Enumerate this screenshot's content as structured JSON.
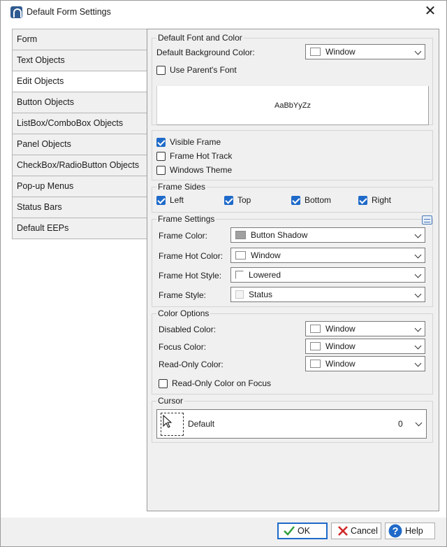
{
  "window": {
    "title": "Default Form Settings",
    "close_glyph": "✕"
  },
  "nav": {
    "items": [
      {
        "label": "Form"
      },
      {
        "label": "Text Objects"
      },
      {
        "label": "Edit Objects",
        "active": true
      },
      {
        "label": "Button Objects"
      },
      {
        "label": "ListBox/ComboBox Objects"
      },
      {
        "label": "Panel Objects"
      },
      {
        "label": "CheckBox/RadioButton Objects"
      },
      {
        "label": "Pop-up Menus"
      },
      {
        "label": "Status Bars"
      },
      {
        "label": "Default EEPs"
      }
    ]
  },
  "font_color": {
    "legend": "Default Font and Color",
    "bg_label": "Default Background Color:",
    "bg_value": "Window",
    "use_parent_font": {
      "label": "Use Parent's Font",
      "checked": false
    },
    "preview_text": "AaBbYyZz"
  },
  "frame_options": {
    "visible_frame": {
      "label": "Visible Frame",
      "checked": true
    },
    "frame_hot_track": {
      "label": "Frame Hot Track",
      "checked": false
    },
    "windows_theme": {
      "label": "Windows Theme",
      "checked": false
    }
  },
  "frame_sides": {
    "legend": "Frame Sides",
    "left": {
      "label": "Left",
      "checked": true
    },
    "top": {
      "label": "Top",
      "checked": true
    },
    "bottom": {
      "label": "Bottom",
      "checked": true
    },
    "right": {
      "label": "Right",
      "checked": true
    }
  },
  "frame_settings": {
    "legend": "Frame Settings",
    "frame_color": {
      "label": "Frame Color:",
      "value": "Button Shadow",
      "swatch": "#a0a0a0"
    },
    "frame_hot_color": {
      "label": "Frame Hot Color:",
      "value": "Window",
      "swatch": "#ffffff"
    },
    "frame_hot_style": {
      "label": "Frame Hot Style:",
      "value": "Lowered"
    },
    "frame_style": {
      "label": "Frame Style:",
      "value": "Status"
    }
  },
  "color_options": {
    "legend": "Color Options",
    "disabled": {
      "label": "Disabled Color:",
      "value": "Window"
    },
    "focus": {
      "label": "Focus Color:",
      "value": "Window"
    },
    "readonly": {
      "label": "Read-Only Color:",
      "value": "Window"
    },
    "readonly_on_focus": {
      "label": "Read-Only Color on Focus",
      "checked": false
    }
  },
  "cursor": {
    "legend": "Cursor",
    "name": "Default",
    "id": "0"
  },
  "buttons": {
    "ok": "OK",
    "cancel": "Cancel",
    "help": "Help"
  },
  "colors": {
    "accent": "#1f6ac9",
    "panel_bg": "#f0f0f0",
    "cancel_red": "#d12a2a",
    "ok_green": "#2e9d3a",
    "help_blue": "#1f6ac9"
  }
}
